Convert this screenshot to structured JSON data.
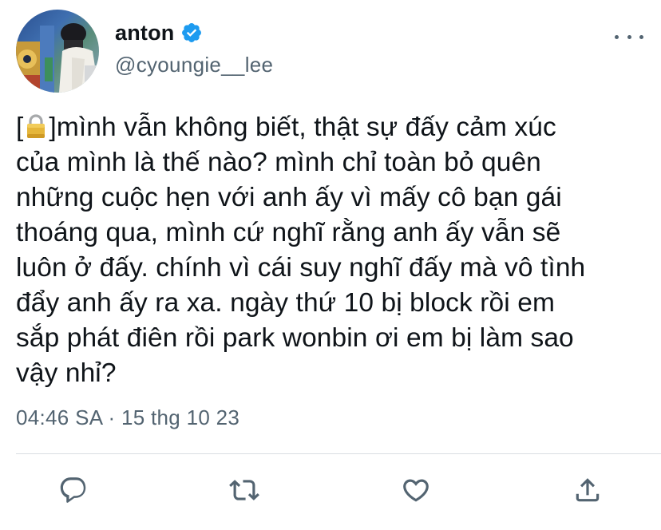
{
  "author": {
    "display_name": "anton",
    "handle": "@cyoungie__lee",
    "verified": true
  },
  "tweet": {
    "text_before_icon": "[",
    "text_after_icon": "]mình vẫn không biết, thật sự đấy cảm xúc\ncủa mình là thế nào? mình chỉ toàn bỏ quên\nnhững cuộc hẹn với anh ấy vì mấy cô bạn gái\nthoáng qua, mình cứ nghĩ rằng anh ấy vẫn sẽ\nluôn ở đấy. chính vì cái suy nghĩ đấy mà vô tình\nđẩy anh ấy ra xa. ngày thứ 10 bị block rồi em\nsắp phát điên rồi park wonbin ơi em bị làm sao\nvậy nhỉ?",
    "inline_icon": "lock-icon",
    "time": "04:46 SA",
    "separator": "·",
    "date": "15 thg 10 23"
  },
  "actions": [
    "reply-icon",
    "retweet-icon",
    "like-icon",
    "share-icon"
  ],
  "colors": {
    "text": "#0f1419",
    "secondary": "#536471",
    "verified": "#1d9bf0",
    "divider": "#d9dee2"
  }
}
